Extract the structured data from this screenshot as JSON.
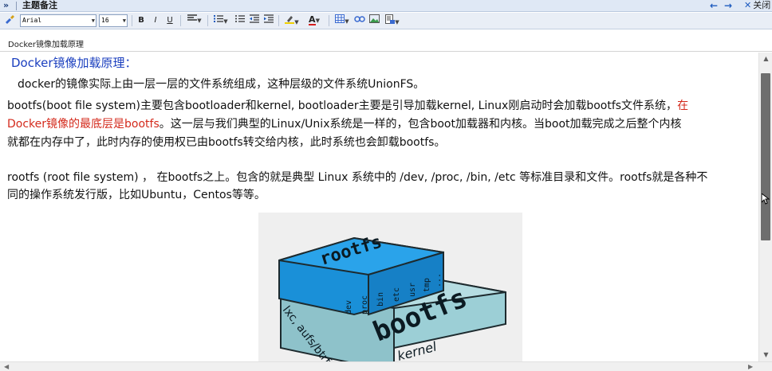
{
  "titlebar": {
    "expand_icon": "»",
    "title": "主题备注",
    "back_icon": "←",
    "forward_icon": "→",
    "close_icon": "✕",
    "close_label": "关闭"
  },
  "toolbar": {
    "font_family": "Arial",
    "font_size": "16",
    "bold": "B",
    "italic": "I",
    "underline": "U"
  },
  "subject": "Docker镜像加载原理",
  "content": {
    "heading": "Docker镜像加载原理：",
    "para1": "docker的镜像实际上由一层一层的文件系统组成，这种层级的文件系统UnionFS。",
    "para2_line1_a": "bootfs(boot file system)主要包含bootloader和kernel, bootloader主要是引导加载kernel, Linux刚启动时会加载bootfs文件系统，",
    "para2_line1_red": "在",
    "para2_line2_red": "Docker镜像的最底层是bootfs",
    "para2_line2_b": "。这一层与我们典型的Linux/Unix系统是一样的，包含boot加载器和内核。当boot加载完成之后整个内核",
    "para2_line3": "就都在内存中了，此时内存的使用权已由bootfs转交给内核，此时系统也会卸载bootfs。",
    "para3_line1": "rootfs (root file system) ， 在bootfs之上。包含的就是典型 Linux 系统中的 /dev, /proc, /bin, /etc 等标准目录和文件。rootfs就是各种不",
    "para3_line2": "同的操作系统发行版，比如Ubuntu，Centos等等。"
  },
  "diagram": {
    "rootfs_label": "rootfs",
    "bootfs_label": "bootfs",
    "dirs": [
      "dev",
      "proc",
      "bin",
      "etc",
      "usr",
      "tmp",
      "..."
    ],
    "side_label": "lxc, aufs/btrfs",
    "kernel_label": "kernel",
    "colors": {
      "rootfs": "#1a90d8",
      "bootfs": "#9ccfd6",
      "background": "#efefef"
    }
  },
  "icons": [
    "expand-icon",
    "back-icon",
    "forward-icon",
    "close-icon",
    "format-painter-icon",
    "align-icon",
    "numbered-list-icon",
    "bullet-list-icon",
    "outdent-icon",
    "indent-icon",
    "highlight-icon",
    "font-color-icon",
    "table-icon",
    "link-icon",
    "image-icon",
    "insert-icon"
  ]
}
